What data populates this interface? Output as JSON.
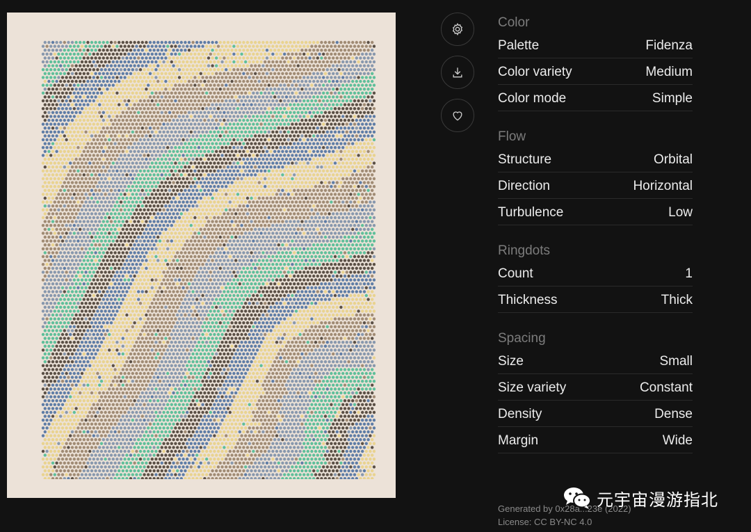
{
  "artwork": {
    "colors": [
      "#e9d38f",
      "#5f7da6",
      "#5b5046",
      "#5fbf9a",
      "#8898ad",
      "#a08b74"
    ]
  },
  "actions": [
    {
      "name": "settings",
      "icon": "gear-icon"
    },
    {
      "name": "download",
      "icon": "download-icon"
    },
    {
      "name": "favorite",
      "icon": "heart-icon"
    }
  ],
  "sections": [
    {
      "title": "Color",
      "rows": [
        {
          "label": "Palette",
          "value": "Fidenza"
        },
        {
          "label": "Color variety",
          "value": "Medium"
        },
        {
          "label": "Color mode",
          "value": "Simple"
        }
      ]
    },
    {
      "title": "Flow",
      "rows": [
        {
          "label": "Structure",
          "value": "Orbital"
        },
        {
          "label": "Direction",
          "value": "Horizontal"
        },
        {
          "label": "Turbulence",
          "value": "Low"
        }
      ]
    },
    {
      "title": "Ringdots",
      "rows": [
        {
          "label": "Count",
          "value": "1"
        },
        {
          "label": "Thickness",
          "value": "Thick"
        }
      ]
    },
    {
      "title": "Spacing",
      "rows": [
        {
          "label": "Size",
          "value": "Small"
        },
        {
          "label": "Size variety",
          "value": "Constant"
        },
        {
          "label": "Density",
          "value": "Dense"
        },
        {
          "label": "Margin",
          "value": "Wide"
        }
      ]
    }
  ],
  "footer": {
    "generated": "Generated by 0x28a...23e (2022)",
    "license": "License: CC BY-NC 4.0"
  },
  "watermark": {
    "text": "元宇宙漫游指北"
  }
}
